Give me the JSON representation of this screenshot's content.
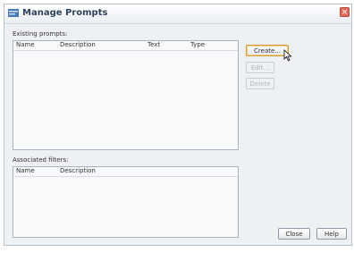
{
  "window": {
    "title": "Manage Prompts",
    "icon": "manage-prompts-app-icon",
    "close_glyph": "×"
  },
  "existing_prompts": {
    "label": "Existing prompts:",
    "columns": [
      "Name",
      "Description",
      "Text",
      "Type"
    ],
    "rows": []
  },
  "associated_filters": {
    "label": "Associated filters:",
    "columns": [
      "Name",
      "Description"
    ],
    "rows": []
  },
  "actions": {
    "create": "Create...",
    "edit": "Edit...",
    "delete": "Delete"
  },
  "footer": {
    "close": "Close",
    "help": "Help"
  },
  "colors": {
    "accent": "#d49a3a",
    "title_text": "#30435c"
  }
}
